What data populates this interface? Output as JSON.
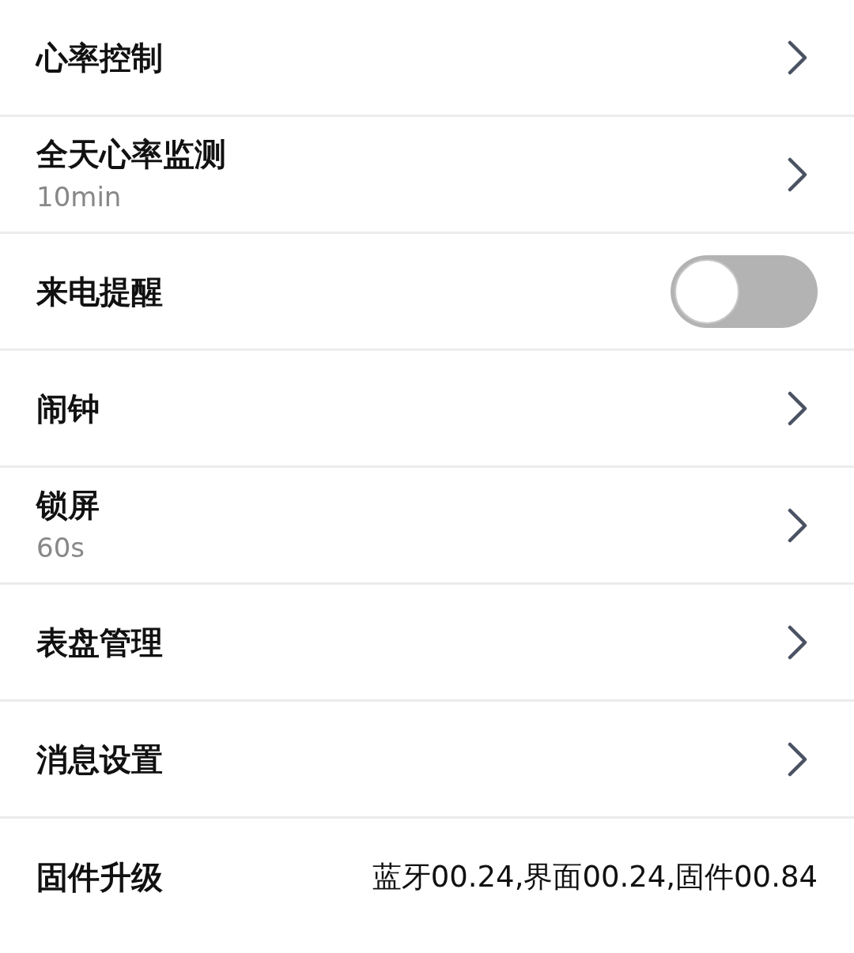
{
  "settings": [
    {
      "kind": "link",
      "title": "心率控制"
    },
    {
      "kind": "link",
      "title": "全天心率监测",
      "subtitle": "10min"
    },
    {
      "kind": "toggle",
      "title": "来电提醒",
      "on": false
    },
    {
      "kind": "link",
      "title": "闹钟"
    },
    {
      "kind": "link",
      "title": "锁屏",
      "subtitle": "60s"
    },
    {
      "kind": "link",
      "title": "表盘管理"
    },
    {
      "kind": "link",
      "title": "消息设置"
    },
    {
      "kind": "value",
      "title": "固件升级",
      "value": "蓝牙00.24,界面00.24,固件00.84"
    }
  ]
}
